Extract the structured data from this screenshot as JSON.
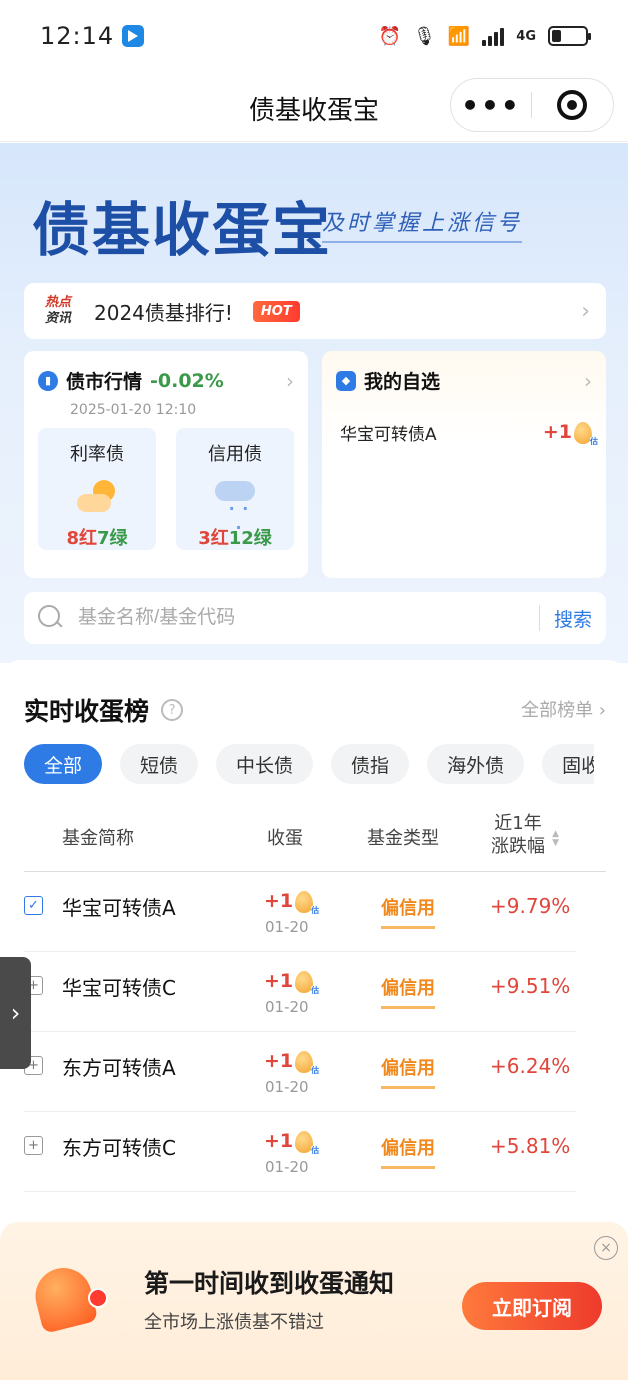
{
  "status": {
    "time": "12:14",
    "network": "4G"
  },
  "nav": {
    "title": "债基收蛋宝",
    "more": "•••"
  },
  "hero": {
    "title": "债基收蛋宝",
    "slogan": "及时掌握上涨信号"
  },
  "news": {
    "tag_top": "热点",
    "tag_bottom": "资讯",
    "text": "2024债基排行!",
    "badge": "HOT"
  },
  "market": {
    "title": "债市行情",
    "change": "-0.02%",
    "date": "2025-01-20 12:10",
    "tiles": [
      {
        "name": "利率债",
        "icon": "sun-cloud-icon",
        "red": "8红",
        "green": "7绿"
      },
      {
        "name": "信用债",
        "icon": "rain-cloud-icon",
        "red": "3红",
        "green": "12绿"
      }
    ]
  },
  "watchlist": {
    "title": "我的自选",
    "items": [
      {
        "name": "华宝可转债A",
        "eggs": "+1"
      }
    ]
  },
  "search": {
    "placeholder": "基金名称/基金代码",
    "button": "搜索"
  },
  "ranking": {
    "title": "实时收蛋榜",
    "help": "?",
    "all_label": "全部榜单 ›",
    "tabs": [
      "全部",
      "短债",
      "中长债",
      "债指",
      "海外债",
      "固收+"
    ],
    "active_tab": "全部",
    "columns": {
      "name": "基金简称",
      "eggs": "收蛋",
      "type": "基金类型",
      "change_line1": "近1年",
      "change_line2": "涨跌幅"
    },
    "rows": [
      {
        "name": "华宝可转债A",
        "eggs": "+1",
        "date": "01-20",
        "type": "偏信用",
        "change": "+9.79%",
        "checked": true
      },
      {
        "name": "华宝可转债C",
        "eggs": "+1",
        "date": "01-20",
        "type": "偏信用",
        "change": "+9.51%",
        "checked": false
      },
      {
        "name": "东方可转债A",
        "eggs": "+1",
        "date": "01-20",
        "type": "偏信用",
        "change": "+6.24%",
        "checked": false
      },
      {
        "name": "东方可转债C",
        "eggs": "+1",
        "date": "01-20",
        "type": "偏信用",
        "change": "+5.81%",
        "checked": false
      }
    ]
  },
  "popup": {
    "title": "第一时间收到收蛋通知",
    "subtitle": "全市场上涨债基不错过",
    "button": "立即订阅",
    "close": "×"
  },
  "colors": {
    "brand_blue": "#2f7be5",
    "red": "#e0463b",
    "green": "#3a9a4a",
    "orange": "#f08a1e"
  }
}
